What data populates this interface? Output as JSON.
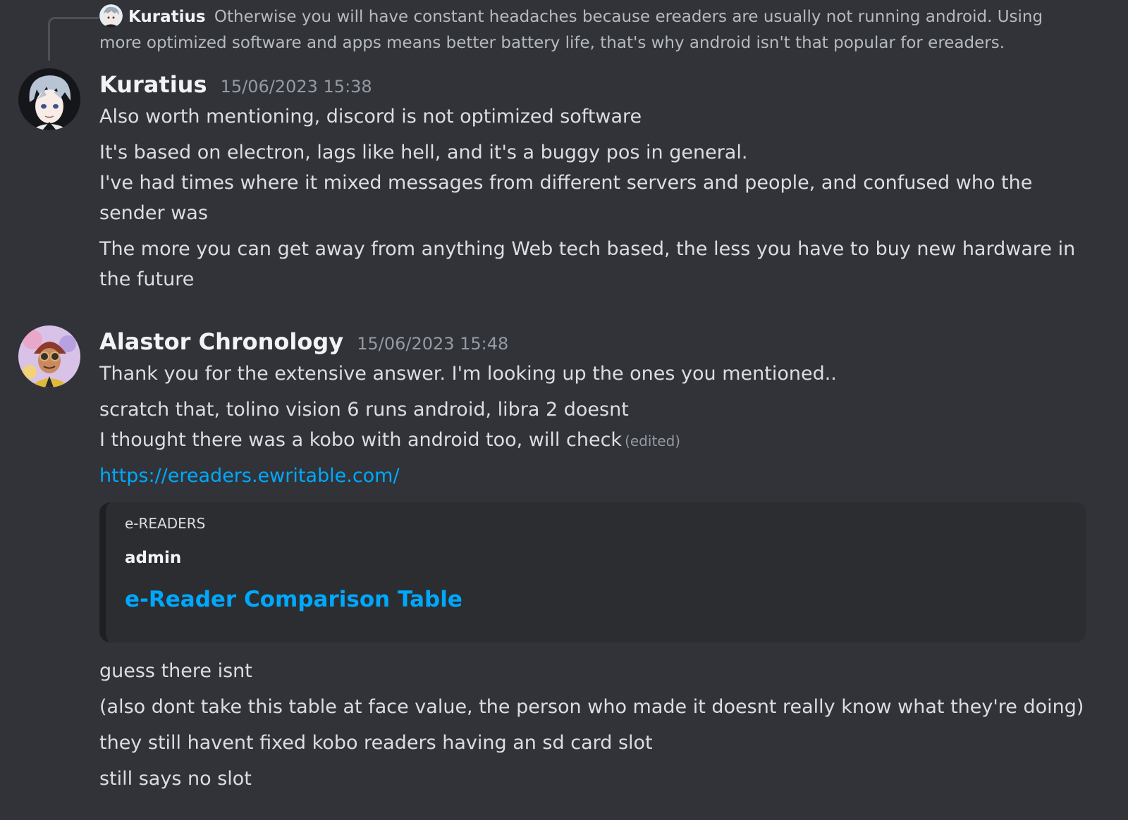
{
  "reply": {
    "author": "Kuratius",
    "text": "Otherwise you will have constant  headaches because ereaders are usually not running android.  Using more optimized software and apps means better battery life, that's why android isn't that popular for ereaders."
  },
  "messages": [
    {
      "author": "Kuratius",
      "timestamp": "15/06/2023 15:38",
      "lines": [
        "Also worth mentioning, discord is not optimized software",
        "It's based on electron, lags like hell, and it's a buggy pos in general.",
        "I've had times where it mixed messages from different servers and people, and confused who the sender was",
        "The more you can get away from anything Web tech based, the less you have to buy new hardware in the future"
      ]
    },
    {
      "author": "Alastor Chronology",
      "timestamp": "15/06/2023 15:48",
      "lines": [
        "Thank you for the extensive answer. I'm looking up the ones you mentioned..",
        "scratch that, tolino vision 6 runs android, libra 2 doesnt",
        "I thought there was a kobo with android too, will check",
        "https://ereaders.ewritable.com/",
        "guess there isnt",
        "(also dont take this table at face value, the person who made it doesnt really know what they're doing)",
        "they still havent fixed kobo readers having an sd card slot",
        "still says no slot"
      ],
      "edited_label": "(edited)",
      "embed": {
        "provider": "e-READERS",
        "author": "admin",
        "title": "e-Reader Comparison Table"
      }
    }
  ],
  "colors": {
    "background": "#313338",
    "embed_bg": "#2b2d31",
    "link": "#00a8fc",
    "text": "#dbdee1",
    "muted": "#949ba4"
  }
}
